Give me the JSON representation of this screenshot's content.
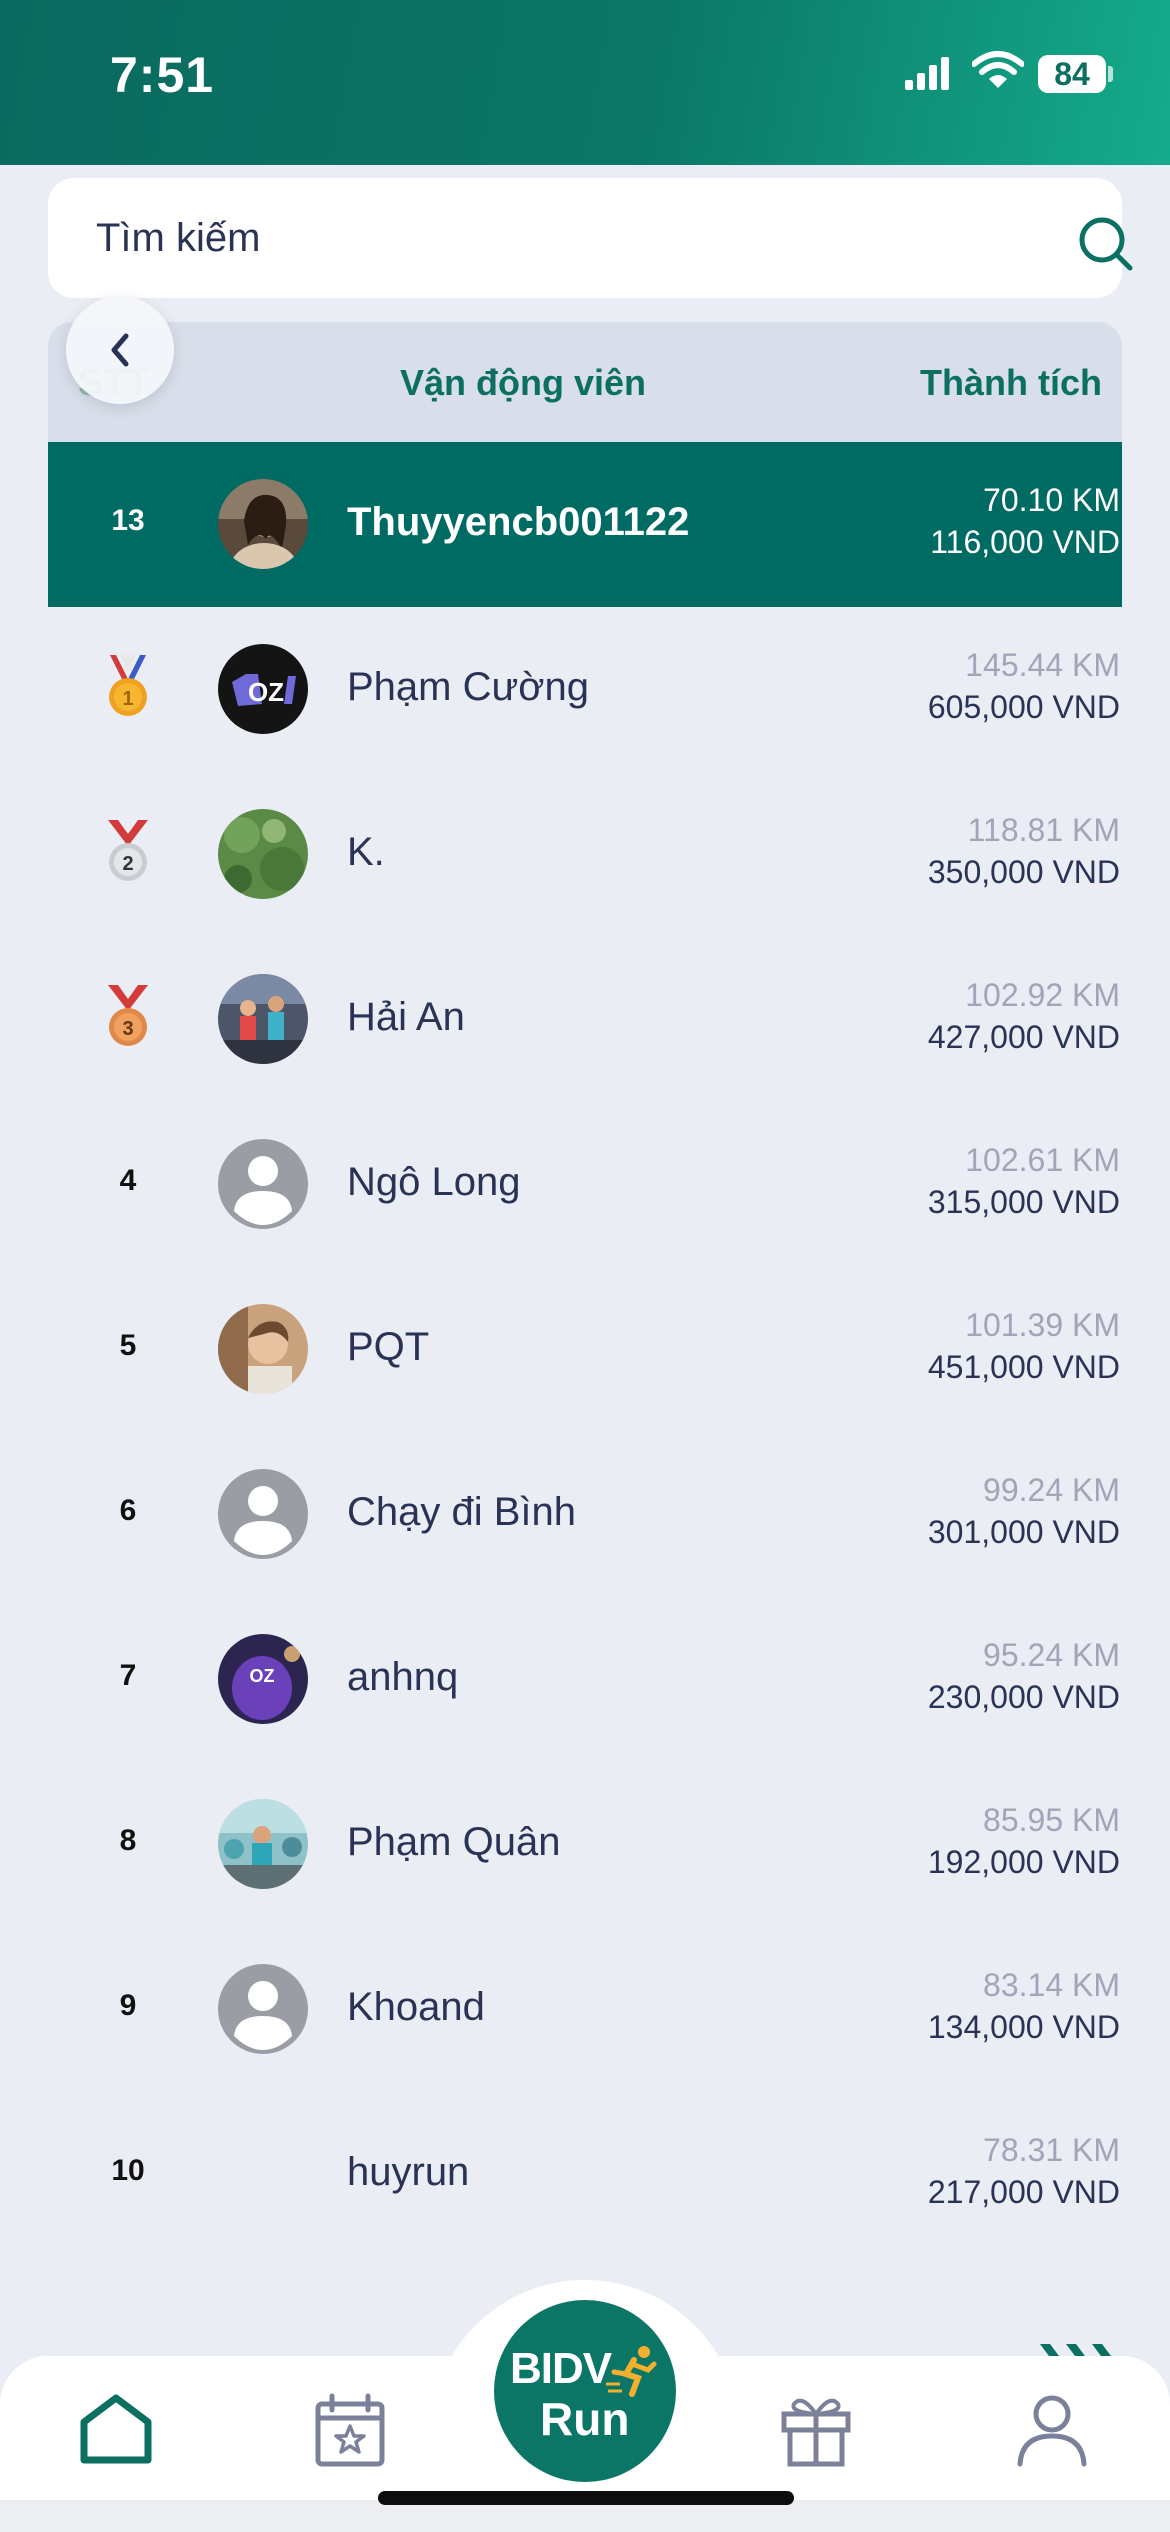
{
  "status_bar": {
    "time": "7:51",
    "battery": "84"
  },
  "search": {
    "placeholder": "Tìm kiếm"
  },
  "table_header": {
    "rank": "STT",
    "athlete": "Vận động viên",
    "result": "Thành tích"
  },
  "rows": [
    {
      "rank": "13",
      "name": "Thuyyencb001122",
      "km": "70.10 KM",
      "vnd": "116,000 VND",
      "highlight": true
    },
    {
      "rank": "1",
      "name": "Phạm Cường",
      "km": "145.44 KM",
      "vnd": "605,000 VND"
    },
    {
      "rank": "2",
      "name": "K.",
      "km": "118.81 KM",
      "vnd": "350,000 VND"
    },
    {
      "rank": "3",
      "name": "Hải An",
      "km": "102.92 KM",
      "vnd": "427,000 VND"
    },
    {
      "rank": "4",
      "name": "Ngô Long",
      "km": "102.61 KM",
      "vnd": "315,000 VND"
    },
    {
      "rank": "5",
      "name": "PQT",
      "km": "101.39 KM",
      "vnd": "451,000 VND"
    },
    {
      "rank": "6",
      "name": "Chạy đi Bình",
      "km": "99.24 KM",
      "vnd": "301,000 VND"
    },
    {
      "rank": "7",
      "name": "anhnq",
      "km": "95.24 KM",
      "vnd": "230,000 VND"
    },
    {
      "rank": "8",
      "name": "Phạm Quân",
      "km": "85.95 KM",
      "vnd": "192,000 VND"
    },
    {
      "rank": "9",
      "name": "Khoand",
      "km": "83.14 KM",
      "vnd": "134,000 VND"
    },
    {
      "rank": "10",
      "name": "huyrun",
      "km": "78.31 KM",
      "vnd": "217,000 VND"
    }
  ],
  "bottom_nav": {
    "logo_line1": "BIDV",
    "logo_line2": "Run",
    "items": [
      "home-icon",
      "calendar-star-icon",
      "bidv-run-logo",
      "gift-icon",
      "profile-icon"
    ]
  },
  "colors": {
    "primary": "#0b6f62",
    "highlight_row": "#006b63",
    "background": "#eaedf3",
    "medal_gold": "#f0a020"
  }
}
